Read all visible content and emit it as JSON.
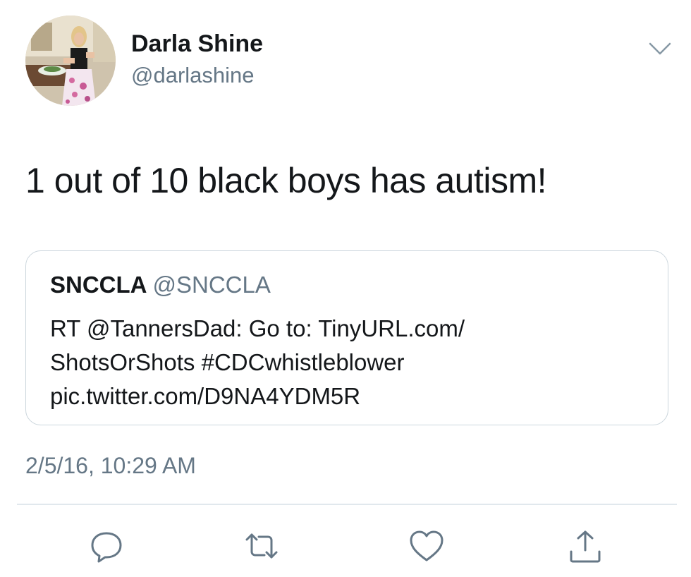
{
  "author": {
    "display_name": "Darla Shine",
    "handle": "@darlashine"
  },
  "tweet": {
    "text": "1 out of 10 black boys has autism!"
  },
  "quoted_tweet": {
    "display_name": "SNCCLA",
    "handle": "@SNCCLA",
    "lines": [
      "RT @TannersDad: Go to: TinyURL.com/",
      "ShotsOrShots #CDCwhistleblower",
      "pic.twitter.com/D9NA4YDM5R"
    ]
  },
  "timestamp": "2/5/16, 10:29 AM",
  "actions": {
    "reply_icon": "reply-icon",
    "retweet_icon": "retweet-icon",
    "like_icon": "heart-icon",
    "share_icon": "share-icon"
  },
  "colors": {
    "text_primary": "#14171a",
    "text_secondary": "#657786",
    "border": "#ccd6dd",
    "divider": "#e1e8ed"
  }
}
